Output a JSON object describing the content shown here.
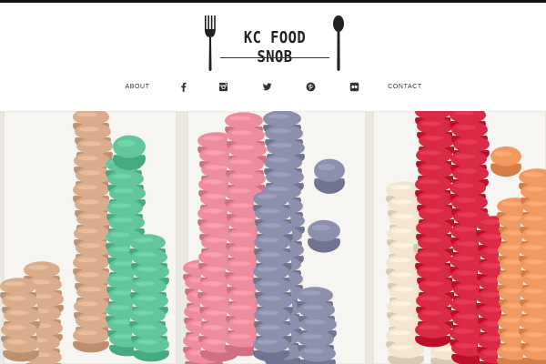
{
  "site": {
    "title": "KC FOOD SNOB",
    "logo_icons": [
      "fork-icon",
      "spoon-icon"
    ]
  },
  "nav": {
    "items": [
      {
        "type": "text",
        "label": "ABOUT"
      },
      {
        "type": "icon",
        "icon": "facebook-icon"
      },
      {
        "type": "icon",
        "icon": "instagram-icon"
      },
      {
        "type": "icon",
        "icon": "twitter-icon"
      },
      {
        "type": "icon",
        "icon": "pinterest-icon"
      },
      {
        "type": "icon",
        "icon": "flickr-icon"
      },
      {
        "type": "text",
        "label": "CONTACT"
      }
    ]
  },
  "hero": {
    "image": "macarons-photo",
    "colors": {
      "tan": "#d9ad8c",
      "mint": "#62c59b",
      "pink": "#ec8c9c",
      "lavender": "#8d90ad",
      "cream": "#f3e5d1",
      "red": "#db2a45",
      "orange": "#f09a62",
      "tray": "#f7f5f1"
    }
  }
}
